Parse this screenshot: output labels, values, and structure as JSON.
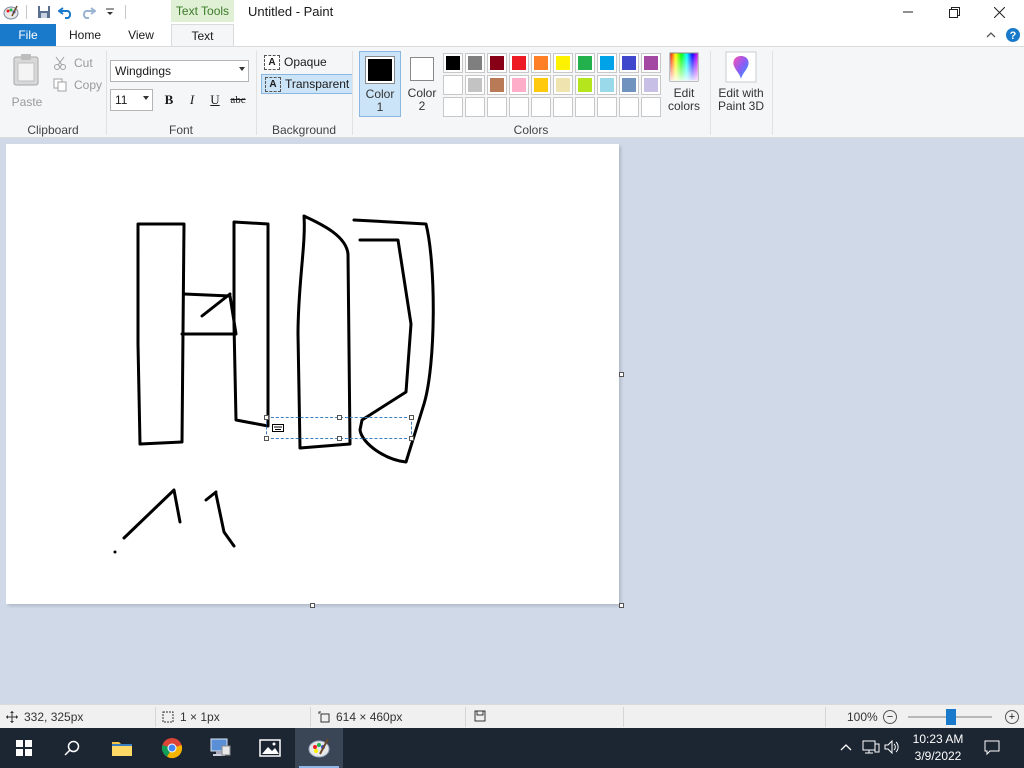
{
  "titlebar": {
    "contextual_tab": "Text Tools",
    "title": "Untitled - Paint"
  },
  "tabs": {
    "file": "File",
    "home": "Home",
    "view": "View",
    "text": "Text"
  },
  "clipboard": {
    "paste": "Paste",
    "cut": "Cut",
    "copy": "Copy",
    "label": "Clipboard"
  },
  "font": {
    "family": "Wingdings",
    "size": "11",
    "bold": "B",
    "italic": "I",
    "underline": "U",
    "strikethrough": "abc",
    "label": "Font"
  },
  "background": {
    "opaque": "Opaque",
    "transparent": "Transparent",
    "label": "Background"
  },
  "colors": {
    "color1_label": "Color 1",
    "color2_label": "Color 2",
    "color1": "#000000",
    "color2": "#ffffff",
    "palette": [
      "#000000",
      "#7f7f7f",
      "#880015",
      "#ed1c24",
      "#ff7f27",
      "#fff200",
      "#22b14c",
      "#00a2e8",
      "#3f48cc",
      "#a349a4",
      "#ffffff",
      "#c3c3c3",
      "#b97a57",
      "#ffaec9",
      "#ffc90e",
      "#efe4b0",
      "#b5e61d",
      "#99d9ea",
      "#7092be",
      "#c8bfe7",
      "#ffffff",
      "#ffffff",
      "#ffffff",
      "#ffffff",
      "#ffffff",
      "#ffffff",
      "#ffffff",
      "#ffffff",
      "#ffffff",
      "#ffffff"
    ],
    "edit_colors": "Edit colors",
    "label": "Colors"
  },
  "paint3d": {
    "label": "Edit with Paint 3D"
  },
  "statusbar": {
    "cursor_pos": "332, 325px",
    "selection_size": "1 × 1px",
    "canvas_size": "614 × 460px",
    "zoom": "100%"
  },
  "taskbar": {
    "time": "10:23 AM",
    "date": "3/9/2022"
  },
  "accent": "#1979ca"
}
